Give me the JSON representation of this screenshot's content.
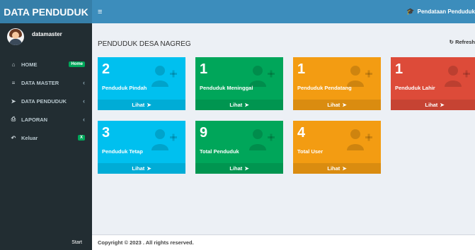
{
  "app": {
    "brand": "DATA PENDUDUK"
  },
  "user": {
    "name": "datamaster"
  },
  "sidebar": {
    "items": [
      {
        "icon": "home-icon",
        "label": "HOME",
        "badge": "Home",
        "chevron": false
      },
      {
        "icon": "database-icon",
        "label": "DATA MASTER",
        "badge": "",
        "chevron": true
      },
      {
        "icon": "send-icon",
        "label": "DATA PENDUDUK",
        "badge": "",
        "chevron": true
      },
      {
        "icon": "print-icon",
        "label": "LAPORAN",
        "badge": "",
        "chevron": true
      },
      {
        "icon": "reply-icon",
        "label": "Keluar",
        "badge": "X",
        "chevron": false
      }
    ],
    "footer": "Start"
  },
  "header": {
    "menu_icon": "hamburger-icon",
    "right_label": "Pendataan Penduduk",
    "right_icon": "graduation-cap-icon"
  },
  "content": {
    "title": "PENDUDUK DESA NAGREG",
    "refresh_label": "Refresh",
    "boxes": [
      {
        "value": "2",
        "label": "Penduduk Pindah",
        "link": "Lihat",
        "color": "#00c0ef"
      },
      {
        "value": "1",
        "label": "Penduduk Meninggal",
        "link": "Lihat",
        "color": "#00a65a"
      },
      {
        "value": "1",
        "label": "Penduduk Pendatang",
        "link": "Lihat",
        "color": "#f39c12"
      },
      {
        "value": "1",
        "label": "Penduduk Lahir",
        "link": "Lihat",
        "color": "#dd4b39"
      },
      {
        "value": "3",
        "label": "Penduduk Tetap",
        "link": "Lihat",
        "color": "#00c0ef"
      },
      {
        "value": "9",
        "label": "Total Penduduk",
        "link": "Lihat",
        "color": "#00a65a"
      },
      {
        "value": "4",
        "label": "Total User",
        "link": "Lihat",
        "color": "#f39c12"
      }
    ]
  },
  "footer": {
    "copyright": "Copyright © 2023 . All rights reserved."
  }
}
